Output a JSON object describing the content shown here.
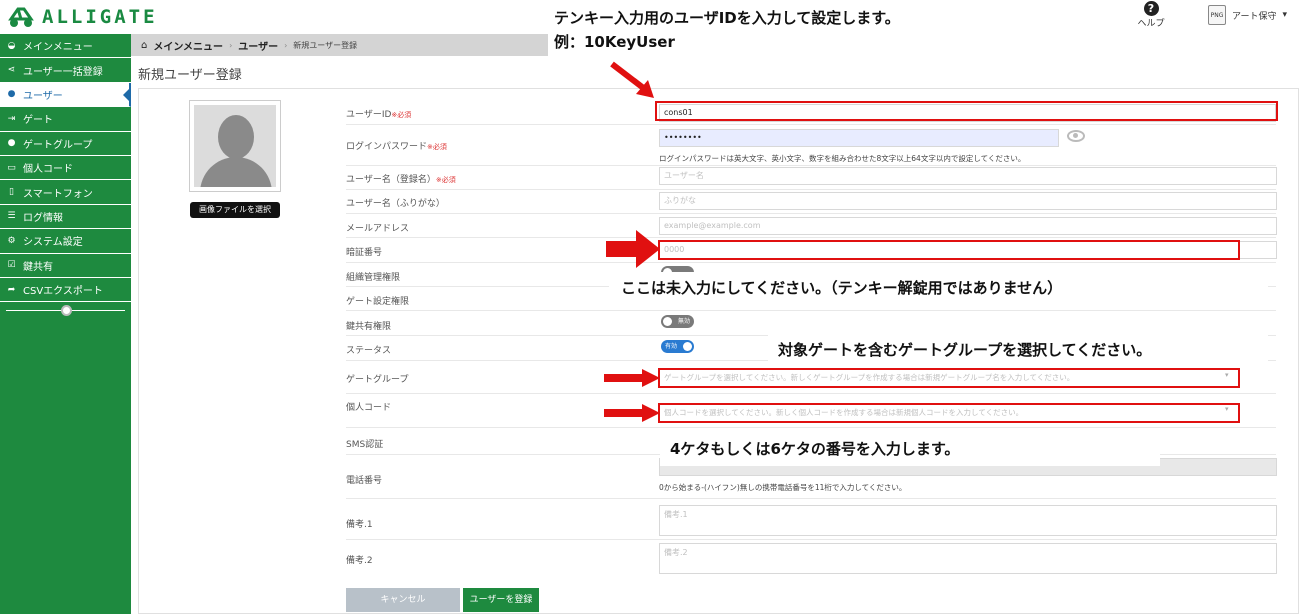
{
  "app": {
    "brand": "ALLIGATE"
  },
  "header": {
    "help_label": "ヘルプ",
    "file_badge": "PNG",
    "user_name": "アート保守"
  },
  "sidebar": {
    "items": [
      {
        "label": "メインメニュー",
        "icon": "dashboard-icon"
      },
      {
        "label": "ユーザー一括登録",
        "icon": "share-icon"
      },
      {
        "label": "ユーザー",
        "icon": "user-icon",
        "active": true
      },
      {
        "label": "ゲート",
        "icon": "sign-in-icon"
      },
      {
        "label": "ゲートグループ",
        "icon": "group-icon"
      },
      {
        "label": "個人コード",
        "icon": "card-icon"
      },
      {
        "label": "スマートフォン",
        "icon": "smartphone-icon"
      },
      {
        "label": "ログ情報",
        "icon": "list-icon"
      },
      {
        "label": "システム設定",
        "icon": "gear-icon"
      },
      {
        "label": "鍵共有",
        "icon": "check-square-icon"
      },
      {
        "label": "CSVエクスポート",
        "icon": "share-arrow-icon"
      }
    ]
  },
  "breadcrumb": {
    "home": "メインメニュー",
    "section": "ユーザー",
    "current": "新規ユーザー登録"
  },
  "page": {
    "title": "新規ユーザー登録",
    "select_image": "画像ファイルを選択"
  },
  "form": {
    "required": "※必須",
    "user_id": {
      "label": "ユーザーID",
      "value": "cons01"
    },
    "password": {
      "label": "ログインパスワード",
      "value": "••••••••",
      "hint": "ログインパスワードは英大文字、英小文字、数字を組み合わせた8文字以上64文字以内で設定してください。"
    },
    "user_name": {
      "label": "ユーザー名（登録名）",
      "placeholder": "ユーザー名"
    },
    "user_kana": {
      "label": "ユーザー名（ふりがな）",
      "placeholder": "ふりがな"
    },
    "email": {
      "label": "メールアドレス",
      "placeholder": "example@example.com"
    },
    "pin": {
      "label": "暗証番号",
      "placeholder": "0000"
    },
    "org_admin": {
      "label": "組織管理権限"
    },
    "gate_admin": {
      "label": "ゲート設定権限"
    },
    "key_share": {
      "label": "鍵共有権限",
      "toggle": "無効"
    },
    "status": {
      "label": "ステータス",
      "toggle": "有効"
    },
    "gate_group": {
      "label": "ゲートグループ",
      "placeholder": "ゲートグループを選択してください。新しくゲートグループを作成する場合は新規ゲートグループ名を入力してください。"
    },
    "personal_code": {
      "label": "個人コード",
      "placeholder": "個人コードを選択してください。新しく個人コードを作成する場合は新規個人コードを入力してください。"
    },
    "sms": {
      "label": "SMS認証"
    },
    "phone": {
      "label": "電話番号",
      "hint": "0から始まる-(ハイフン)無しの携帯電話番号を11桁で入力してください。"
    },
    "note1": {
      "label": "備考.1",
      "placeholder": "備考.1"
    },
    "note2": {
      "label": "備考.2",
      "placeholder": "備考.2"
    },
    "cancel_label": "キャンセル",
    "submit_label": "ユーザーを登録"
  },
  "annotations": {
    "top_line1": "テンキー入力用のユーザIDを入力して設定します。",
    "top_line2": "例：10KeyUser",
    "pin_note": "ここは未入力にしてください。（テンキー解錠用ではありません）",
    "gate_note": "対象ゲートを含むゲートグループを選択してください。",
    "code_note": "4ケタもしくは6ケタの番号を入力します。",
    "highlight_color": "#e01010"
  }
}
